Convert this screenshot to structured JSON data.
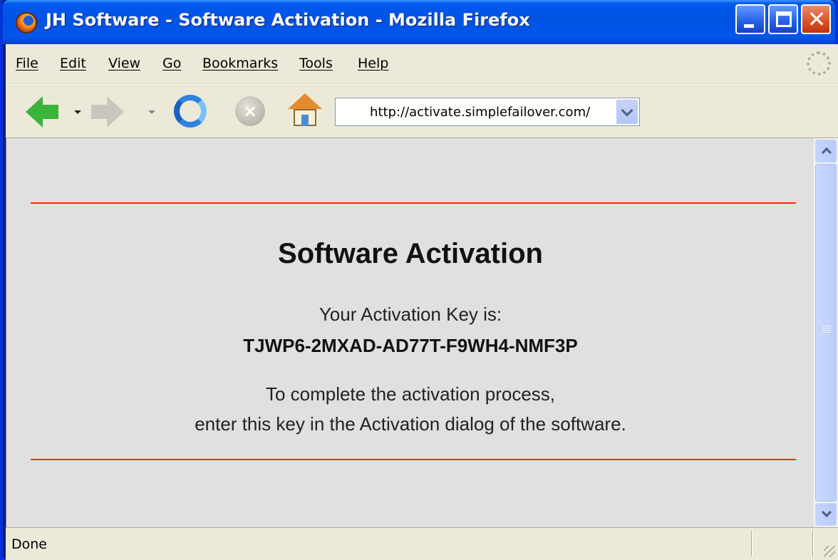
{
  "window": {
    "title": "JH Software - Software Activation - Mozilla Firefox",
    "controls": {
      "minimize": "–",
      "maximize": "□",
      "close": "✕"
    }
  },
  "menubar": {
    "items": [
      {
        "label": "File"
      },
      {
        "label": "Edit"
      },
      {
        "label": "View"
      },
      {
        "label": "Go"
      },
      {
        "label": "Bookmarks"
      },
      {
        "label": "Tools"
      },
      {
        "label": "Help"
      }
    ]
  },
  "navbar": {
    "icons": [
      "back-arrow-icon",
      "forward-arrow-icon",
      "reload-icon",
      "stop-icon",
      "home-icon"
    ],
    "address": "http://activate.simplefailover.com/"
  },
  "page": {
    "heading": "Software Activation",
    "key_label": "Your Activation Key is:",
    "key_value": "TJWP6-2MXAD-AD77T-F9WH4-NMF3P",
    "instructions_line1": "To complete the activation process,",
    "instructions_line2": "enter this key in the Activation dialog of the software.",
    "rule_color": "#ff2a00",
    "background": "#e0e0e0"
  },
  "statusbar": {
    "text": "Done"
  }
}
